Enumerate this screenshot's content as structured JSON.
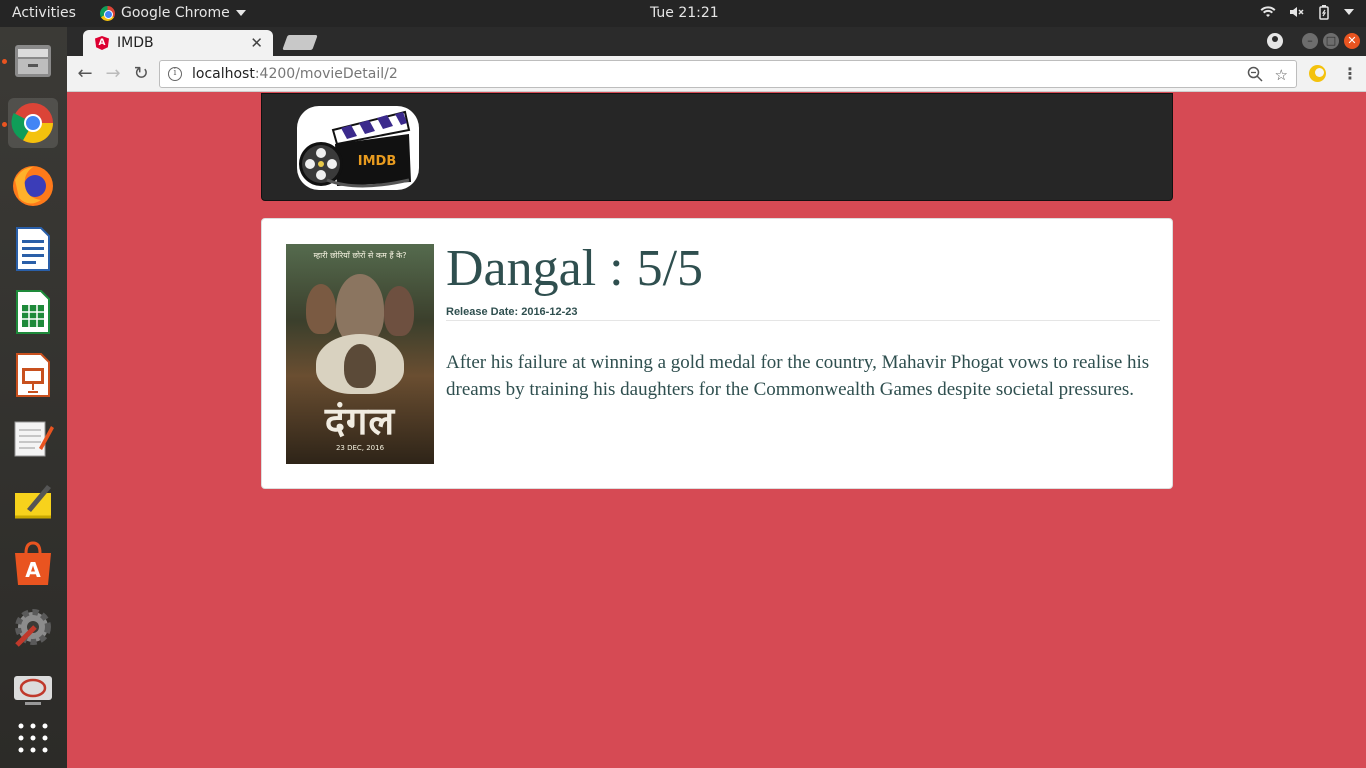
{
  "system": {
    "activities_label": "Activities",
    "app_menu_label": "Google Chrome",
    "clock": "Tue 21:21"
  },
  "dock": {
    "items": [
      {
        "name": "Files",
        "icon": "files-icon"
      },
      {
        "name": "Google Chrome",
        "icon": "chrome-icon"
      },
      {
        "name": "Firefox",
        "icon": "firefox-icon"
      },
      {
        "name": "LibreOffice Writer",
        "icon": "writer-icon"
      },
      {
        "name": "LibreOffice Calc",
        "icon": "calc-icon"
      },
      {
        "name": "LibreOffice Impress",
        "icon": "impress-icon"
      },
      {
        "name": "Text Editor",
        "icon": "text-editor-icon"
      },
      {
        "name": "Notes",
        "icon": "notes-icon"
      },
      {
        "name": "Ubuntu Software",
        "icon": "software-center-icon"
      },
      {
        "name": "System Settings",
        "icon": "settings-icon"
      },
      {
        "name": "Remote Desktop",
        "icon": "remote-desktop-icon"
      },
      {
        "name": "Show Applications",
        "icon": "app-grid-icon"
      }
    ]
  },
  "browser": {
    "tab_title": "IMDB",
    "url_host": "localhost",
    "url_path": ":4200/movieDetail/2"
  },
  "app": {
    "logo_text": "IMDB"
  },
  "movie": {
    "heading": "Dangal : 5/5",
    "release_label": "Release Date: 2016-12-23",
    "plot": "After his failure at winning a gold medal for the country, Mahavir Phogat vows to realise his dreams by training his daughters for the Commonwealth Games despite societal pressures.",
    "poster": {
      "tagline": "म्हारी छोरियाँ छोरों से कम हैं के?",
      "title_art": "दंगल",
      "date_text": "23 DEC, 2016"
    }
  },
  "colors": {
    "page_background": "#d64a54",
    "header_background": "#262626",
    "text_color": "#2f4f4f"
  }
}
